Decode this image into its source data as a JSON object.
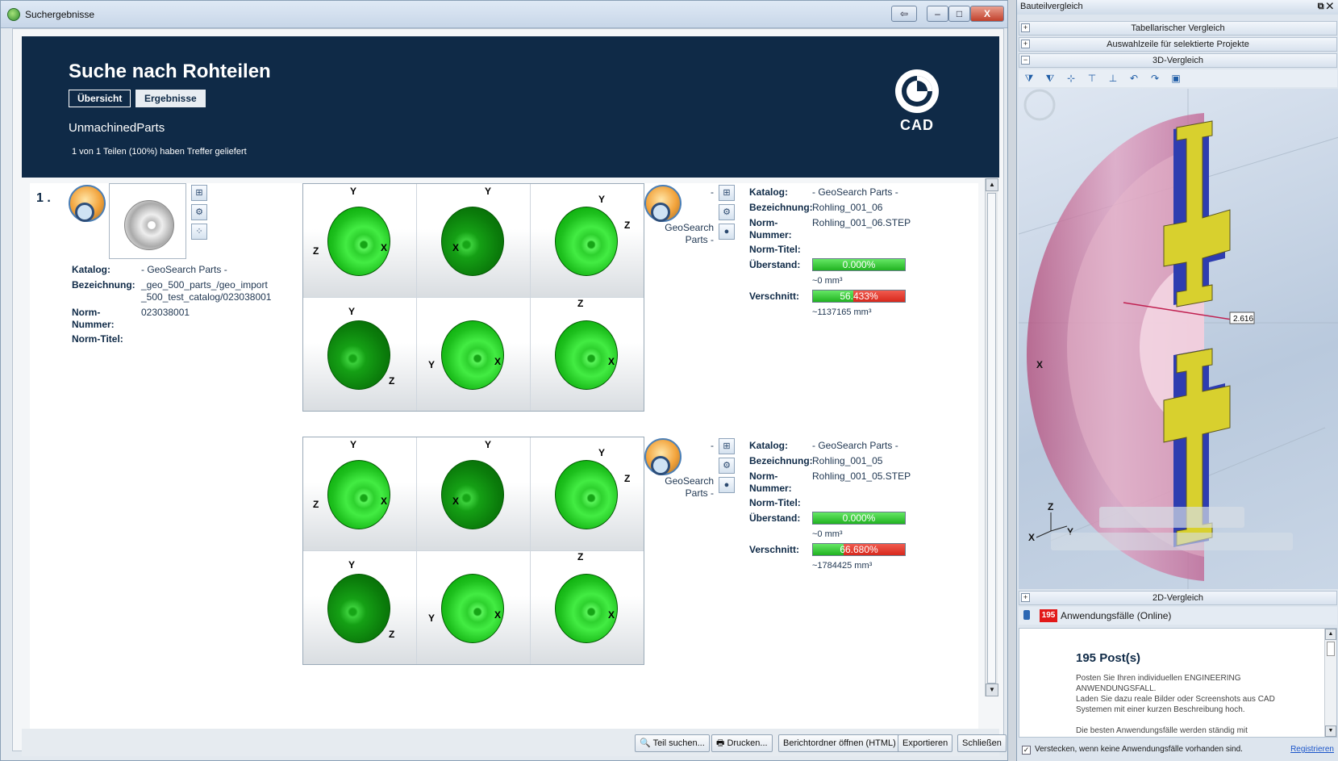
{
  "window": {
    "title": "Suchergebnisse",
    "buttons": {
      "back": "⇦",
      "minimize": "–",
      "maximize": "□",
      "close": "X"
    }
  },
  "banner": {
    "title": "Suche nach Rohteilen",
    "tabs": [
      "Übersicht",
      "Ergebnisse"
    ],
    "subtitle": "UnmachinedParts",
    "info": "1 von 1 Teilen (100%) haben Treffer geliefert",
    "logo_text": "CADENAS"
  },
  "result": {
    "number": "1 .",
    "labels": {
      "catalog": "Katalog:",
      "designation": "Bezeichnung:",
      "norm_number": "Norm-\nNummer:",
      "norm_title": "Norm-Titel:",
      "overhang": "Überstand:",
      "waste": "Verschnitt:"
    },
    "source": {
      "catalog": "- GeoSearch Parts -",
      "designation": "_geo_500_parts_/geo_import\n_500_test_catalog/023038001",
      "norm_number": "023038001",
      "norm_title": ""
    },
    "matches": [
      {
        "source_label": "GeoSearch\nParts -",
        "dash": "-",
        "catalog": "- GeoSearch Parts -",
        "designation": "Rohling_001_06",
        "norm_number": "Rohling_001_06.STEP",
        "norm_title": "",
        "overhang_pct": "0.000%",
        "overhang_fraction": 0,
        "overhang_mm": "~0 mm³",
        "waste_pct": "56.433%",
        "waste_fill_fraction": 0.44,
        "waste_mm": "~1137165 mm³"
      },
      {
        "source_label": "GeoSearch\nParts -",
        "dash": "-",
        "catalog": "- GeoSearch Parts -",
        "designation": "Rohling_001_05",
        "norm_number": "Rohling_001_05.STEP",
        "norm_title": "",
        "overhang_pct": "0.000%",
        "overhang_fraction": 0,
        "overhang_mm": "~0 mm³",
        "waste_pct": "66.680%",
        "waste_fill_fraction": 0.33,
        "waste_mm": "~1784425 mm³"
      }
    ],
    "axis_labels": {
      "x": "X",
      "y": "Y",
      "z": "Z"
    }
  },
  "bottom_buttons": [
    "Teil suchen...",
    "Drucken...",
    "Berichtordner öffnen (HTML)",
    "Exportieren",
    "Schließen"
  ],
  "side_panel": {
    "title": "Bauteilvergleich",
    "sections": [
      "Tabellarischer Vergleich",
      "Auswahlzeile für selektierte Projekte",
      "3D-Vergleich",
      "2D-Vergleich"
    ],
    "measure_value": "2.616",
    "axes": {
      "x": "X",
      "y": "Y",
      "z": "Z"
    },
    "use_cases_count": "195",
    "use_cases_label": "Anwendungsfälle (Online)",
    "posts_title": "195 Post(s)",
    "posts_text": "Posten Sie Ihren individuellen ENGINEERING\nANWENDUNGSFALL.\nLaden Sie dazu reale Bilder oder Screenshots aus CAD\nSystemen mit einer kurzen Beschreibung hoch.\n\nDie besten Anwendungsfälle werden ständig mit",
    "hide_checkbox": "Verstecken, wenn keine Anwendungsfälle vorhanden sind.",
    "register_link": "Registrieren"
  },
  "colors": {
    "banner": "#0f2a47",
    "match_green": "#2ed12e",
    "waste_red": "#d8281c"
  }
}
